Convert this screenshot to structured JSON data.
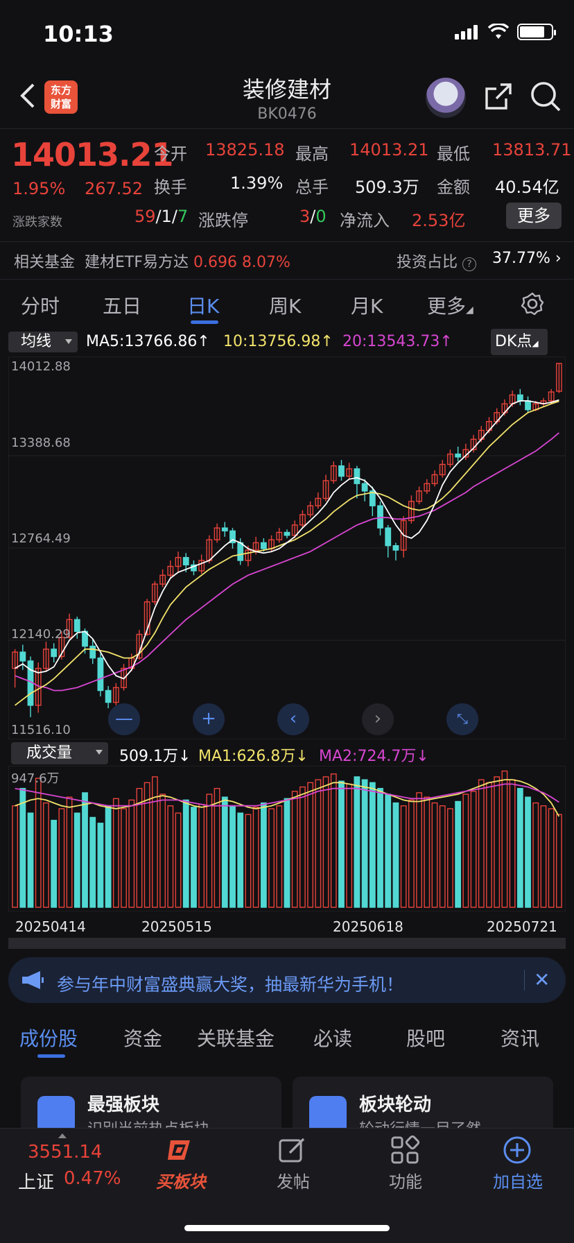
{
  "status": {
    "time": "10:13"
  },
  "nav": {
    "title": "装修建材",
    "code": "BK0476",
    "logo_line1": "东方",
    "logo_line2": "财富"
  },
  "quote": {
    "price": "14013.21",
    "change_pct": "1.95%",
    "change_val": "267.52",
    "updown_label": "涨跌家数",
    "open_label": "今开",
    "open": "13825.18",
    "high_label": "最高",
    "high": "14013.21",
    "low_label": "最低",
    "low": "13813.71",
    "turnover_label": "换手",
    "turnover": "1.39%",
    "volume_label": "总手",
    "volume": "509.3万",
    "amount_label": "金额",
    "amount": "40.54亿",
    "updown_up": "59",
    "updown_sep1": "/",
    "updown_flat": "1",
    "updown_sep2": "/",
    "updown_down": "7",
    "limit_label": "涨跌停",
    "limit_up": "3",
    "limit_sep": "/",
    "limit_down": "0",
    "inflow_label": "净流入",
    "inflow": "2.53亿",
    "more": "更多"
  },
  "fund": {
    "label": "相关基金",
    "name": "建材ETF易方达",
    "price": "0.696",
    "pct": "8.07%",
    "ratio_label": "投资占比",
    "ratio": "37.77%"
  },
  "kline_tabs": [
    "分时",
    "五日",
    "日K",
    "周K",
    "月K",
    "更多"
  ],
  "ma": {
    "select": "均线",
    "ma5": "MA5:13766.86↑",
    "ma10": "10:13756.98↑",
    "ma20": "20:13543.73↑",
    "dk": "DK点"
  },
  "price_ticks": [
    "14012.88",
    "13388.68",
    "12764.49",
    "12140.29",
    "11516.10"
  ],
  "volume": {
    "select": "成交量",
    "value": "509.1万↓",
    "ma1": "MA1:626.8万↓",
    "ma2": "MA2:724.7万↓",
    "max": "947.6万"
  },
  "dates": [
    "20250414",
    "20250515",
    "20250618",
    "20250721"
  ],
  "colors": {
    "up": "#e8433a",
    "down": "#52d8d2",
    "ma5": "#ffffff",
    "ma10": "#f3e46b",
    "ma20": "#d946d1",
    "accent": "#5b8ef0"
  },
  "chart_data": {
    "type": "candlestick",
    "ylim": [
      11516.1,
      14012.88
    ],
    "candles": [
      [
        11950,
        12060,
        11820,
        12080
      ],
      [
        12060,
        12000,
        11940,
        12110
      ],
      [
        12000,
        11700,
        11620,
        12030
      ],
      [
        11700,
        11950,
        11650,
        11990
      ],
      [
        11950,
        12080,
        11930,
        12130
      ],
      [
        12080,
        12030,
        11990,
        12120
      ],
      [
        12030,
        12160,
        12010,
        12200
      ],
      [
        12160,
        12280,
        12150,
        12320
      ],
      [
        12280,
        12200,
        12150,
        12300
      ],
      [
        12200,
        12100,
        12050,
        12220
      ],
      [
        12100,
        12020,
        11980,
        12150
      ],
      [
        12020,
        11800,
        11760,
        12050
      ],
      [
        11800,
        11720,
        11680,
        11830
      ],
      [
        11720,
        11820,
        11700,
        11850
      ],
      [
        11820,
        11950,
        11800,
        11980
      ],
      [
        11950,
        12020,
        11930,
        12050
      ],
      [
        12020,
        12180,
        12010,
        12210
      ],
      [
        12180,
        12400,
        12170,
        12420
      ],
      [
        12400,
        12520,
        12380,
        12540
      ],
      [
        12520,
        12580,
        12500,
        12620
      ],
      [
        12580,
        12640,
        12560,
        12680
      ],
      [
        12640,
        12700,
        12600,
        12740
      ],
      [
        12700,
        12650,
        12600,
        12730
      ],
      [
        12650,
        12610,
        12580,
        12680
      ],
      [
        12610,
        12680,
        12590,
        12720
      ],
      [
        12680,
        12820,
        12660,
        12850
      ],
      [
        12820,
        12900,
        12800,
        12930
      ],
      [
        12900,
        12880,
        12840,
        12940
      ],
      [
        12880,
        12800,
        12760,
        12900
      ],
      [
        12800,
        12680,
        12650,
        12830
      ],
      [
        12680,
        12750,
        12640,
        12780
      ],
      [
        12750,
        12800,
        12720,
        12840
      ],
      [
        12800,
        12760,
        12740,
        12830
      ],
      [
        12760,
        12820,
        12740,
        12850
      ],
      [
        12820,
        12870,
        12800,
        12900
      ],
      [
        12870,
        12850,
        12830,
        12890
      ],
      [
        12850,
        12920,
        12830,
        12950
      ],
      [
        12920,
        12990,
        12900,
        13020
      ],
      [
        12990,
        13050,
        12970,
        13080
      ],
      [
        13050,
        13100,
        13030,
        13140
      ],
      [
        13100,
        13220,
        13080,
        13260
      ],
      [
        13220,
        13320,
        13200,
        13350
      ],
      [
        13320,
        13250,
        13220,
        13360
      ],
      [
        13250,
        13300,
        13230,
        13340
      ],
      [
        13300,
        13200,
        13100,
        13320
      ],
      [
        13200,
        13150,
        13080,
        13230
      ],
      [
        13150,
        13050,
        12980,
        13180
      ],
      [
        13050,
        12900,
        12850,
        13080
      ],
      [
        12900,
        12780,
        12700,
        12920
      ],
      [
        12780,
        12750,
        12680,
        12800
      ],
      [
        12750,
        12950,
        12700,
        12980
      ],
      [
        12950,
        13080,
        12930,
        13120
      ],
      [
        13080,
        13150,
        13060,
        13180
      ],
      [
        13150,
        13200,
        13130,
        13230
      ],
      [
        13200,
        13260,
        13180,
        13290
      ],
      [
        13260,
        13330,
        13240,
        13360
      ],
      [
        13330,
        13400,
        13310,
        13430
      ],
      [
        13400,
        13380,
        13350,
        13450
      ],
      [
        13380,
        13430,
        13360,
        13470
      ],
      [
        13430,
        13500,
        13410,
        13530
      ],
      [
        13500,
        13560,
        13480,
        13590
      ],
      [
        13560,
        13620,
        13540,
        13650
      ],
      [
        13620,
        13680,
        13600,
        13710
      ],
      [
        13680,
        13740,
        13660,
        13770
      ],
      [
        13740,
        13800,
        13720,
        13830
      ],
      [
        13800,
        13760,
        13730,
        13840
      ],
      [
        13760,
        13700,
        13680,
        13790
      ],
      [
        13700,
        13740,
        13690,
        13760
      ],
      [
        13740,
        13760,
        13720,
        13780
      ],
      [
        13760,
        13820,
        13740,
        13840
      ],
      [
        13825,
        14013,
        13813,
        14013
      ]
    ],
    "volumes": [
      700,
      820,
      650,
      890,
      720,
      600,
      680,
      760,
      650,
      790,
      620,
      580,
      700,
      750,
      680,
      740,
      820,
      860,
      900,
      780,
      700,
      650,
      740,
      690,
      710,
      780,
      820,
      760,
      700,
      650,
      640,
      690,
      720,
      680,
      700,
      750,
      800,
      830,
      860,
      880,
      900,
      920,
      870,
      850,
      900,
      880,
      860,
      820,
      780,
      720,
      700,
      740,
      790,
      760,
      720,
      700,
      680,
      730,
      780,
      800,
      880,
      860,
      900,
      940,
      880,
      820,
      760,
      720,
      700,
      680,
      640
    ],
    "ma5": [
      11950,
      11980,
      11940,
      11920,
      11930,
      11960,
      12050,
      12140,
      12190,
      12200,
      12150,
      12060,
      11970,
      11900,
      11880,
      11940,
      12060,
      12210,
      12360,
      12470,
      12560,
      12600,
      12620,
      12640,
      12660,
      12680,
      12730,
      12780,
      12820,
      12800,
      12760,
      12740,
      12730,
      12740,
      12760,
      12800,
      12840,
      12900,
      12950,
      13000,
      13060,
      13140,
      13190,
      13230,
      13240,
      13220,
      13170,
      13100,
      13010,
      12920,
      12850,
      12830,
      12870,
      12950,
      13060,
      13190,
      13280,
      13340,
      13390,
      13440,
      13500,
      13560,
      13620,
      13680,
      13740,
      13760,
      13760,
      13750,
      13740,
      13750,
      13766
    ],
    "ma10": [
      11700,
      11740,
      11780,
      11810,
      11840,
      11880,
      11930,
      11980,
      12030,
      12080,
      12080,
      12070,
      12060,
      12040,
      12020,
      12020,
      12050,
      12110,
      12190,
      12290,
      12380,
      12440,
      12500,
      12540,
      12580,
      12620,
      12650,
      12680,
      12710,
      12720,
      12730,
      12740,
      12750,
      12760,
      12780,
      12800,
      12820,
      12850,
      12880,
      12920,
      12960,
      13010,
      13050,
      13090,
      13120,
      13130,
      13140,
      13130,
      13110,
      13080,
      13050,
      13030,
      13020,
      13030,
      13060,
      13100,
      13150,
      13210,
      13270,
      13330,
      13390,
      13450,
      13500,
      13550,
      13600,
      13640,
      13680,
      13700,
      13720,
      13740,
      13757
    ],
    "ma20": [
      11900,
      11880,
      11860,
      11830,
      11820,
      11800,
      11800,
      11810,
      11820,
      11840,
      11860,
      11880,
      11900,
      11920,
      11940,
      11960,
      11990,
      12030,
      12080,
      12130,
      12180,
      12230,
      12280,
      12320,
      12360,
      12400,
      12440,
      12480,
      12520,
      12550,
      12580,
      12600,
      12620,
      12640,
      12660,
      12680,
      12700,
      12720,
      12740,
      12770,
      12800,
      12830,
      12860,
      12890,
      12920,
      12940,
      12960,
      12970,
      12970,
      12960,
      12960,
      12970,
      12980,
      13000,
      13020,
      13050,
      13080,
      13110,
      13140,
      13180,
      13210,
      13240,
      13270,
      13300,
      13330,
      13360,
      13390,
      13420,
      13460,
      13500,
      13544
    ],
    "vol_ma1": [
      700,
      720,
      740,
      750,
      740,
      720,
      700,
      690,
      700,
      710,
      720,
      700,
      690,
      680,
      690,
      700,
      720,
      740,
      760,
      770,
      760,
      740,
      720,
      700,
      690,
      700,
      720,
      740,
      730,
      710,
      690,
      680,
      690,
      700,
      720,
      740,
      760,
      780,
      800,
      820,
      840,
      860,
      860,
      850,
      840,
      830,
      820,
      800,
      780,
      760,
      740,
      730,
      730,
      740,
      750,
      760,
      770,
      780,
      800,
      820,
      840,
      860,
      870,
      880,
      880,
      870,
      850,
      820,
      780,
      720,
      627
    ],
    "vol_ma2": [
      820,
      810,
      800,
      790,
      780,
      770,
      760,
      750,
      740,
      730,
      720,
      710,
      700,
      700,
      700,
      700,
      710,
      720,
      730,
      740,
      740,
      740,
      730,
      720,
      710,
      700,
      700,
      700,
      700,
      700,
      700,
      700,
      710,
      720,
      730,
      740,
      750,
      760,
      780,
      800,
      810,
      820,
      820,
      820,
      820,
      810,
      800,
      790,
      780,
      770,
      760,
      750,
      750,
      750,
      760,
      770,
      780,
      790,
      800,
      810,
      820,
      830,
      840,
      850,
      850,
      840,
      830,
      810,
      790,
      760,
      725
    ]
  },
  "banner": {
    "text": "参与年中财富盛典赢大奖，抽最新华为手机！",
    "close": "✕"
  },
  "bottom_tabs": [
    "成份股",
    "资金",
    "关联基金",
    "必读",
    "股吧",
    "资讯"
  ],
  "cards": [
    {
      "title": "最强板块",
      "sub": "识别当前热点板块"
    },
    {
      "title": "板块轮动",
      "sub": "轮动行情一目了然"
    }
  ],
  "tabbar": {
    "index_price": "3551.14",
    "index_name": "上证",
    "index_pct": "0.47%",
    "buy": "买板块",
    "post": "发帖",
    "func": "功能",
    "add": "加自选"
  }
}
